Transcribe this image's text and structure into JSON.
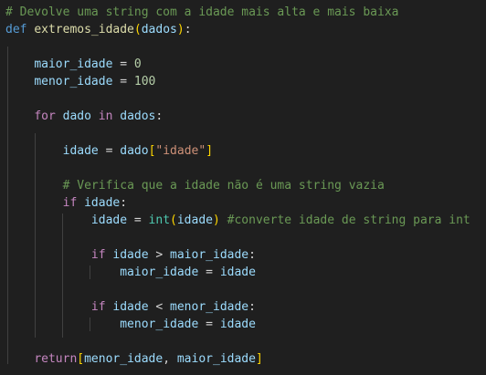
{
  "code": {
    "comment_header": "# Devolve uma string com a idade mais alta e mais baixa",
    "kw_def": "def",
    "fn_name": "extremos_idade",
    "param_dados": "dados",
    "var_maior_idade": "maior_idade",
    "var_menor_idade": "menor_idade",
    "num_zero": "0",
    "num_hundred": "100",
    "kw_for": "for",
    "var_dado": "dado",
    "kw_in": "in",
    "var_idade": "idade",
    "str_idade": "\"idade\"",
    "comment_verifica": "# Verifica que a idade não é uma string vazia",
    "kw_if": "if",
    "builtin_int": "int",
    "comment_converte": "#converte idade de string para int",
    "kw_return": "return"
  },
  "colors": {
    "background": "#1f1f1f",
    "comment": "#6a9955",
    "keyword": "#569cd6",
    "control": "#c586c0",
    "function": "#dcdcaa",
    "variable": "#9cdcfe",
    "number": "#b5cea8",
    "string": "#ce9178",
    "builtin": "#4ec9b0",
    "bracket_gold": "#ffd700",
    "bracket_orchid": "#da70d6"
  }
}
